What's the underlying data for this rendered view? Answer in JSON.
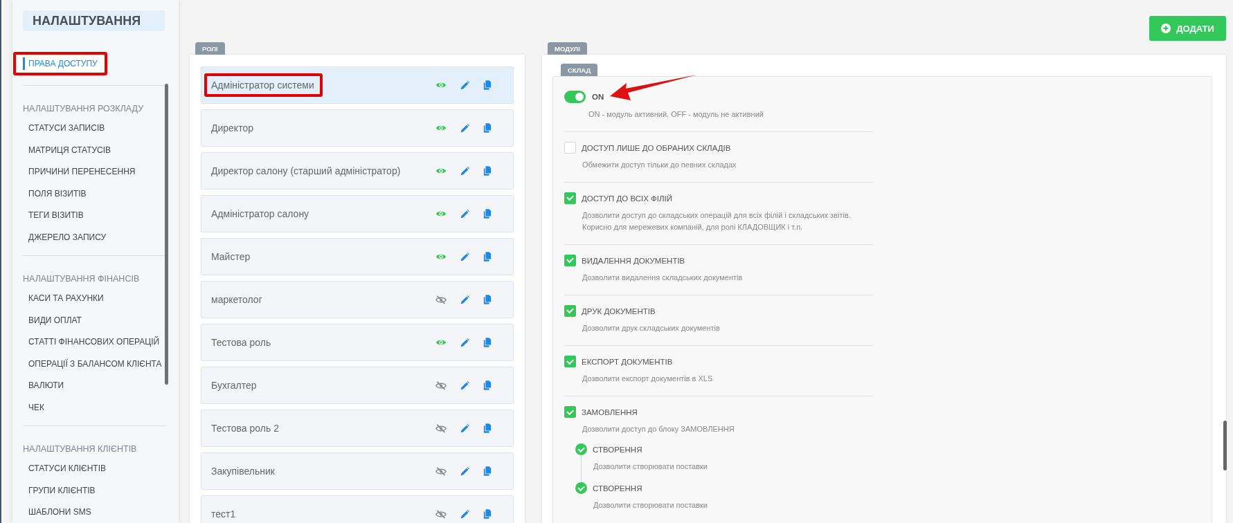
{
  "sidebar": {
    "title": "НАЛАШТУВАННЯ",
    "top_items": [
      {
        "label": "ПРАВА ДОСТУПУ",
        "selected": true,
        "highlighted": true
      }
    ],
    "sections": [
      {
        "header": "НАЛАШТУВАННЯ РОЗКЛАДУ",
        "items": [
          {
            "label": "СТАТУСИ ЗАПИСІВ",
            "selected": false
          },
          {
            "label": "МАТРИЦЯ СТАТУСІВ",
            "selected": false
          },
          {
            "label": "ПРИЧИНИ ПЕРЕНЕСЕННЯ",
            "selected": false
          },
          {
            "label": "ПОЛЯ ВІЗИТІВ",
            "selected": false
          },
          {
            "label": "ТЕГИ ВІЗИТІВ",
            "selected": false
          },
          {
            "label": "ДЖЕРЕЛО ЗАПИСУ",
            "selected": false
          }
        ]
      },
      {
        "header": "НАЛАШТУВАННЯ ФІНАНСІВ",
        "items": [
          {
            "label": "КАСИ ТА РАХУНКИ",
            "selected": false
          },
          {
            "label": "ВИДИ ОПЛАТ",
            "selected": false
          },
          {
            "label": "СТАТТІ ФІНАНСОВИХ ОПЕРАЦІЙ",
            "selected": false
          },
          {
            "label": "ОПЕРАЦІЇ З БАЛАНСОМ КЛІЄНТА",
            "selected": false
          },
          {
            "label": "ВАЛЮТИ",
            "selected": false
          },
          {
            "label": "ЧЕК",
            "selected": false
          }
        ]
      },
      {
        "header": "НАЛАШТУВАННЯ КЛІЄНТІВ",
        "items": [
          {
            "label": "СТАТУСИ КЛІЄНТІВ",
            "selected": false
          },
          {
            "label": "ГРУПИ КЛІЄНТІВ",
            "selected": false
          },
          {
            "label": "ШАБЛОНИ SMS",
            "selected": false
          }
        ]
      }
    ]
  },
  "add_button": {
    "label": "ДОДАТИ"
  },
  "roles": {
    "tab": "РОЛІ",
    "items": [
      {
        "name": "Адміністратор системи",
        "selected": true,
        "visible": true,
        "highlighted": true
      },
      {
        "name": "Директор",
        "selected": false,
        "visible": true,
        "highlighted": false
      },
      {
        "name": "Директор салону (старший адміністратор)",
        "selected": false,
        "visible": true,
        "highlighted": false
      },
      {
        "name": "Адміністратор салону",
        "selected": false,
        "visible": true,
        "highlighted": false
      },
      {
        "name": "Майстер",
        "selected": false,
        "visible": true,
        "highlighted": false
      },
      {
        "name": "маркетолог",
        "selected": false,
        "visible": false,
        "highlighted": false
      },
      {
        "name": "Тестова роль",
        "selected": false,
        "visible": true,
        "highlighted": false
      },
      {
        "name": "Бухгалтер",
        "selected": false,
        "visible": false,
        "highlighted": false
      },
      {
        "name": "Тестова роль 2",
        "selected": false,
        "visible": false,
        "highlighted": false
      },
      {
        "name": "Закупівельник",
        "selected": false,
        "visible": false,
        "highlighted": false
      },
      {
        "name": "тест1",
        "selected": false,
        "visible": false,
        "highlighted": false
      }
    ]
  },
  "modules": {
    "tab": "МОДУЛІ",
    "module_tab": "СКЛАД",
    "settings": [
      {
        "kind": "toggle",
        "label": "ON",
        "description": "ON - модуль активний. OFF - модуль не активний",
        "on": true,
        "pointed": true
      },
      {
        "kind": "checkbox",
        "label": "ДОСТУП ЛИШЕ ДО ОБРАНИХ СКЛАДІВ",
        "description": "Обмежити доступ тільки до певних складах",
        "checked": false
      },
      {
        "kind": "checkbox",
        "label": "ДОСТУП ДО ВСІХ ФІЛІЙ",
        "description": "Дозволити доступ до складських операцій для всіх філій і складських звітів. Корисно для мережевих компаній, для ролі КЛАДОВЩИК і т.п.",
        "checked": true
      },
      {
        "kind": "checkbox",
        "label": "ВИДАЛЕННЯ ДОКУМЕНТІВ",
        "description": "Дозволити видалення складських документів",
        "checked": true
      },
      {
        "kind": "checkbox",
        "label": "ДРУК ДОКУМЕНТІВ",
        "description": "Дозволити друк складських документів",
        "checked": true
      },
      {
        "kind": "checkbox",
        "label": "ЕКСПОРТ ДОКУМЕНТІВ",
        "description": "Дозволити експорт документів в XLS",
        "checked": true
      },
      {
        "kind": "checkbox",
        "label": "ЗАМОВЛЕННЯ",
        "description": "Дозволити доступ до блоку ЗАМОВЛЕННЯ",
        "checked": true,
        "children": [
          {
            "label": "СТВОРЕННЯ",
            "description": "Дозволити створювати поставки",
            "checked": true
          },
          {
            "label": "СТВОРЕННЯ",
            "description": "Дозволити створювати поставки",
            "checked": true
          }
        ]
      }
    ]
  }
}
